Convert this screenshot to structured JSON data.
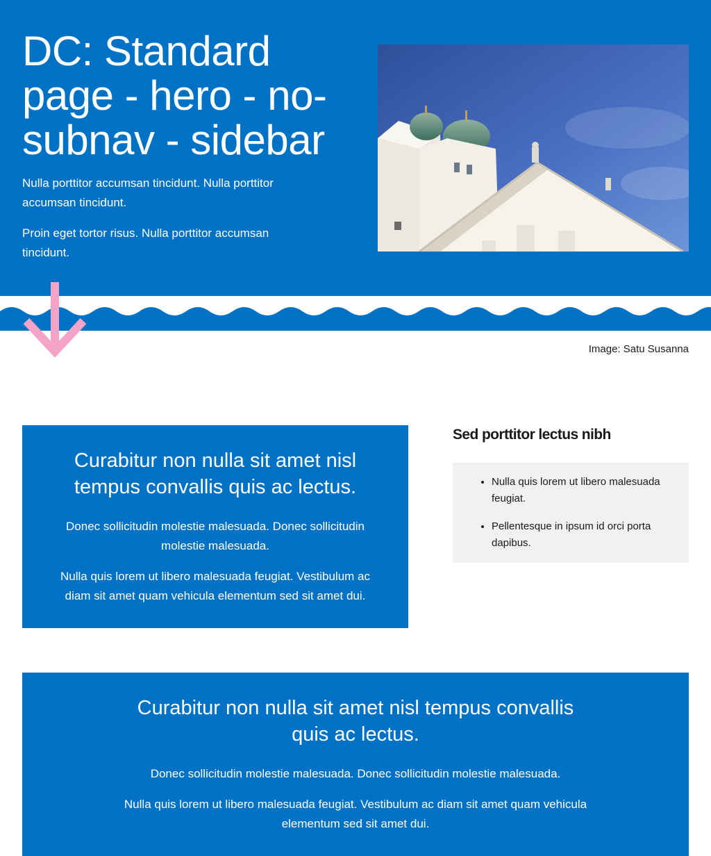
{
  "hero": {
    "title": "DC: Standard page - hero - no-subnav - sidebar",
    "paragraphs": [
      "Nulla porttitor accumsan tincidunt. Nulla porttitor accumsan tincidunt.",
      "Proin eget tortor risus. Nulla porttitor accumsan tincidunt."
    ],
    "image_credit": "Image: Satu Susanna"
  },
  "highlight": {
    "heading": "Curabitur non nulla sit amet nisl tempus convallis quis ac lectus.",
    "paragraphs": [
      "Donec sollicitudin molestie malesuada. Donec sollicitudin molestie malesuada.",
      "Nulla quis lorem ut libero malesuada feugiat. Vestibulum ac diam sit amet quam vehicula elementum sed sit amet dui."
    ]
  },
  "sidebar": {
    "heading": "Sed porttitor lectus nibh",
    "items": [
      "Nulla quis lorem ut libero malesuada feugiat.",
      "Pellentesque in ipsum id orci porta dapibus."
    ]
  },
  "wide_highlight": {
    "heading": "Curabitur non nulla sit amet nisl tempus convallis quis ac lectus.",
    "paragraphs": [
      "Donec sollicitudin molestie malesuada. Donec sollicitudin molestie malesuada.",
      "Nulla quis lorem ut libero malesuada feugiat. Vestibulum ac diam sit amet quam vehicula elementum sed sit amet dui."
    ]
  },
  "colors": {
    "brand_blue": "#0072c6",
    "accent_pink": "#f5a3c7",
    "sidebar_bg": "#f1f1f1"
  },
  "icons": [
    "arrow-down-icon",
    "wave-divider"
  ]
}
